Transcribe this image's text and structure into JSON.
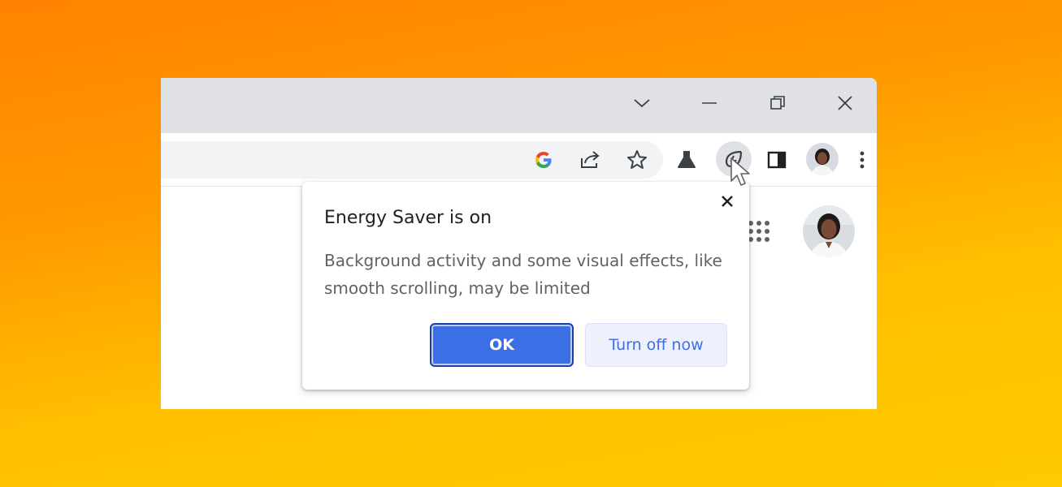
{
  "window": {
    "titlebar": {
      "controls": [
        "tab-search",
        "minimize",
        "restore",
        "close"
      ]
    },
    "toolbar": {
      "icons": [
        "google-lens-icon",
        "share-icon",
        "star-icon",
        "labs-flask-icon",
        "energy-saver-icon",
        "side-panel-icon",
        "profile-avatar",
        "more-menu-icon"
      ]
    }
  },
  "popup": {
    "title": "Energy Saver is on",
    "body_line1": "Background activity and some visual effects, like",
    "body_line2": "smooth scrolling, may be limited",
    "ok_label": "OK",
    "turn_off_label": "Turn off now"
  },
  "colors": {
    "accent": "#3c6ee6",
    "background_top": "#ff8200",
    "background_bottom": "#ffca00"
  }
}
